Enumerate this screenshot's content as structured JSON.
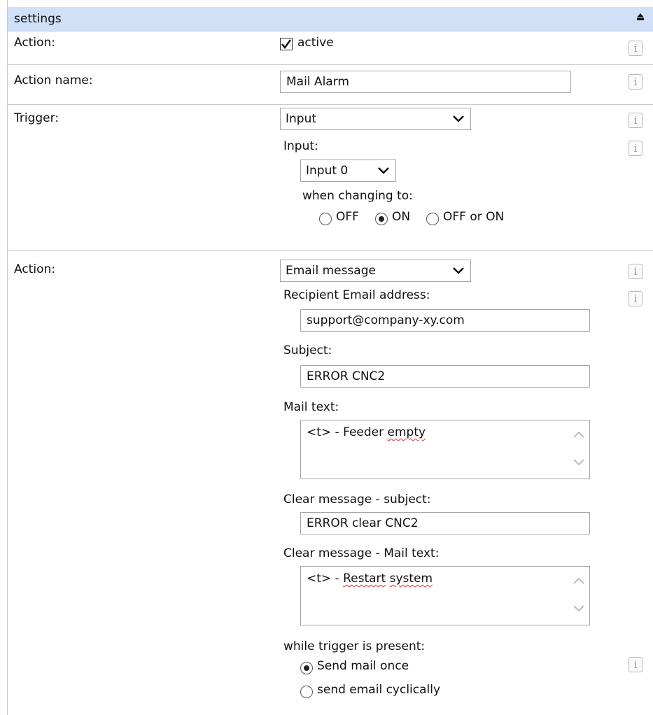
{
  "header": {
    "title": "settings"
  },
  "active_row": {
    "label": "Action:",
    "checkbox_label": "active",
    "checked": true
  },
  "name_row": {
    "label": "Action name:",
    "value": "Mail Alarm"
  },
  "trigger_row": {
    "label": "Trigger:",
    "trigger_select": "Input",
    "input_label": "Input:",
    "input_select": "Input 0",
    "changing_label": "when changing to:",
    "options": [
      "OFF",
      "ON",
      "OFF or ON"
    ],
    "selected": "ON"
  },
  "action_row": {
    "label": "Action:",
    "action_select": "Email message",
    "recipient_label": "Recipient Email address:",
    "recipient_value": "support@company-xy.com",
    "subject_label": "Subject:",
    "subject_value": "ERROR CNC2",
    "mail_text_label": "Mail text:",
    "mail_text_prefix": "<t> - Feeder ",
    "mail_text_word": "empty",
    "clear_subject_label": "Clear message - subject:",
    "clear_subject_value": "ERROR clear CNC2",
    "clear_text_label": "Clear message - Mail text:",
    "clear_text_prefix": "<t> - ",
    "clear_text_word1": "Restart",
    "clear_text_word2": "system",
    "while_label": "while trigger is present:",
    "mail_options": [
      "Send mail once",
      "send email cyclically"
    ],
    "mail_selected": "Send mail once"
  },
  "icons": {
    "info": "i",
    "info_icon": "info-icon",
    "collapse_icon": "collapse-up-icon"
  }
}
